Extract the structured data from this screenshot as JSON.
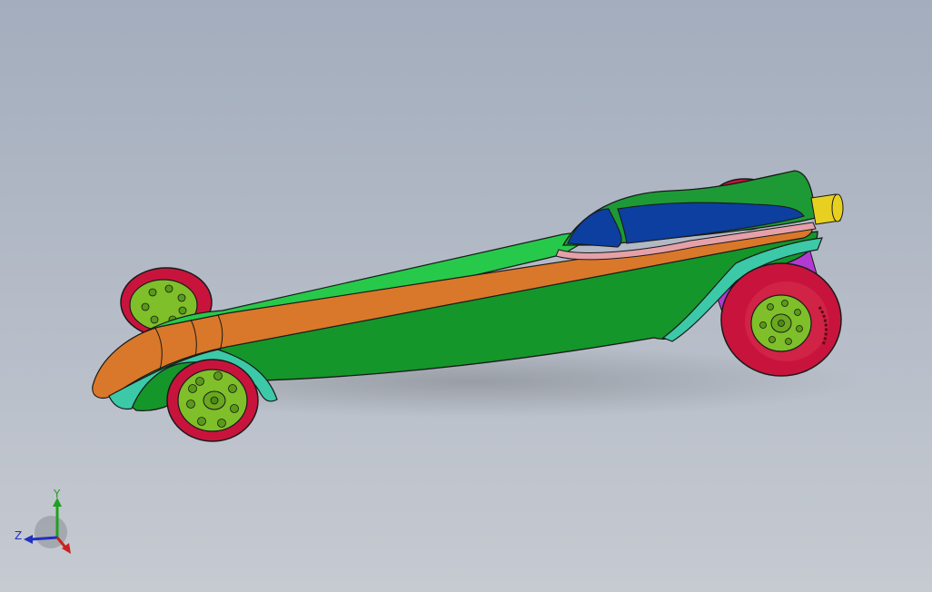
{
  "viewport": {
    "background_top": "#a3adbd",
    "background_bottom": "#c6cad1"
  },
  "model": {
    "colors": {
      "body_green": "#27c94a",
      "body_dark_green": "#14962a",
      "spine_orange": "#d9782a",
      "fender_teal": "#3cc9a8",
      "canopy_blue": "#0c3fa0",
      "canopy_green": "#1d9a35",
      "trim_pink": "#e6a0a8",
      "wheel_red": "#c8143c",
      "rim_green": "#7fbf2a",
      "exhaust_yellow": "#e8d020",
      "axle_magenta": "#b13ad0",
      "edge": "#1a1a1a"
    }
  },
  "triad": {
    "y_label": "Y",
    "z_label": "Z",
    "x_color": "#cc2020",
    "y_color": "#20a020",
    "z_color": "#2030c0"
  }
}
